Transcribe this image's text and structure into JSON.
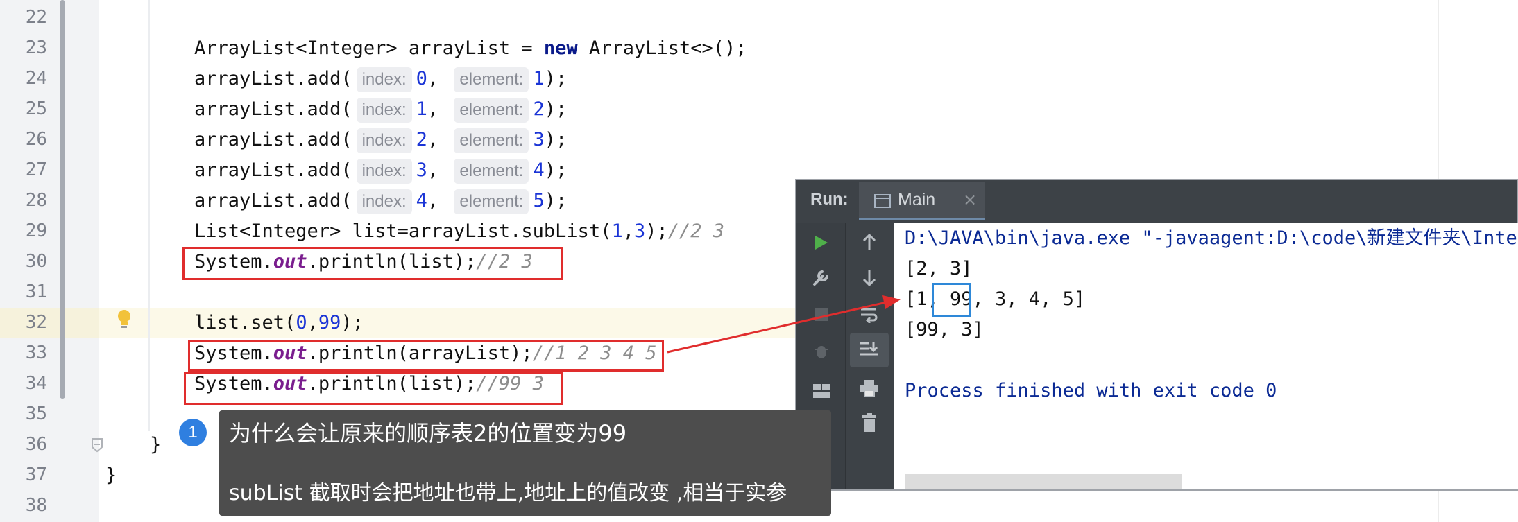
{
  "editor": {
    "line_numbers": [
      "22",
      "23",
      "24",
      "25",
      "26",
      "27",
      "28",
      "29",
      "30",
      "31",
      "32",
      "33",
      "34",
      "35",
      "36",
      "37",
      "38"
    ],
    "lines": {
      "l23": {
        "type": "ArrayList<Integer> arrayList = ",
        "kw": "new",
        "rest": " ArrayList<>();"
      },
      "add_calls": [
        {
          "prefix": "arrayList.add(",
          "index_hint": "index:",
          "index": "0",
          "element_hint": "element:",
          "element": "1",
          "suffix": ");"
        },
        {
          "prefix": "arrayList.add(",
          "index_hint": "index:",
          "index": "1",
          "element_hint": "element:",
          "element": "2",
          "suffix": ");"
        },
        {
          "prefix": "arrayList.add(",
          "index_hint": "index:",
          "index": "2",
          "element_hint": "element:",
          "element": "3",
          "suffix": ");"
        },
        {
          "prefix": "arrayList.add(",
          "index_hint": "index:",
          "index": "3",
          "element_hint": "element:",
          "element": "4",
          "suffix": ");"
        },
        {
          "prefix": "arrayList.add(",
          "index_hint": "index:",
          "index": "4",
          "element_hint": "element:",
          "element": "5",
          "suffix": ");"
        }
      ],
      "l29": {
        "a": "List<Integer> list=arrayList.subList(",
        "n1": "1",
        "comma": ",",
        "n2": "3",
        "close": ");",
        "comment": "//2 3"
      },
      "l30": {
        "a": "System.",
        "field": "out",
        "b": ".println(list);",
        "comment": "//2 3"
      },
      "l32": {
        "a": "list.set(",
        "n1": "0",
        "comma": ",",
        "n2": "99",
        "close": ");"
      },
      "l33": {
        "a": "System.",
        "field": "out",
        "b": ".println(arrayList);",
        "comment": "//1 2 3 4 5"
      },
      "l34": {
        "a": "System.",
        "field": "out",
        "b": ".println(list);",
        "comment": "//99 3"
      },
      "l36": {
        "text": "}"
      },
      "l37": {
        "text": "}"
      }
    }
  },
  "run_panel": {
    "label": "Run:",
    "tab_label": "Main",
    "tab_close": "×",
    "console": [
      {
        "text": "D:\\JAVA\\bin\\java.exe \"-javaagent:D:\\code\\新建文件夹\\Intell",
        "color": "#0b2a94"
      },
      {
        "text": "[2, 3]",
        "color": "#111111"
      },
      {
        "text": "[1, 99, 3, 4, 5]",
        "color": "#111111"
      },
      {
        "text": "[99, 3]",
        "color": "#111111"
      },
      {
        "text": "",
        "color": "#111111"
      },
      {
        "text": "Process finished with exit code 0",
        "color": "#0b2a94"
      }
    ],
    "toolbar_icons": [
      "run-icon",
      "wrench-icon",
      "stop-icon",
      "debug-icon",
      "layout-icon",
      "pin-icon",
      "up-arrow-icon",
      "down-arrow-icon",
      "soft-wrap-icon",
      "scroll-to-end-icon",
      "print-icon",
      "trash-icon"
    ]
  },
  "annotation": {
    "badge": "1",
    "title": "为什么会让原来的顺序表2的位置变为99",
    "body": "subList 截取时会把地址也带上,地址上的值改变 ,相当于实参"
  },
  "colors": {
    "highlight_box": "#e02d2d",
    "value_box": "#2e88d8",
    "keyword": "#0a1a8a",
    "number": "#1a34d6",
    "static_field": "#7a1d8e"
  }
}
